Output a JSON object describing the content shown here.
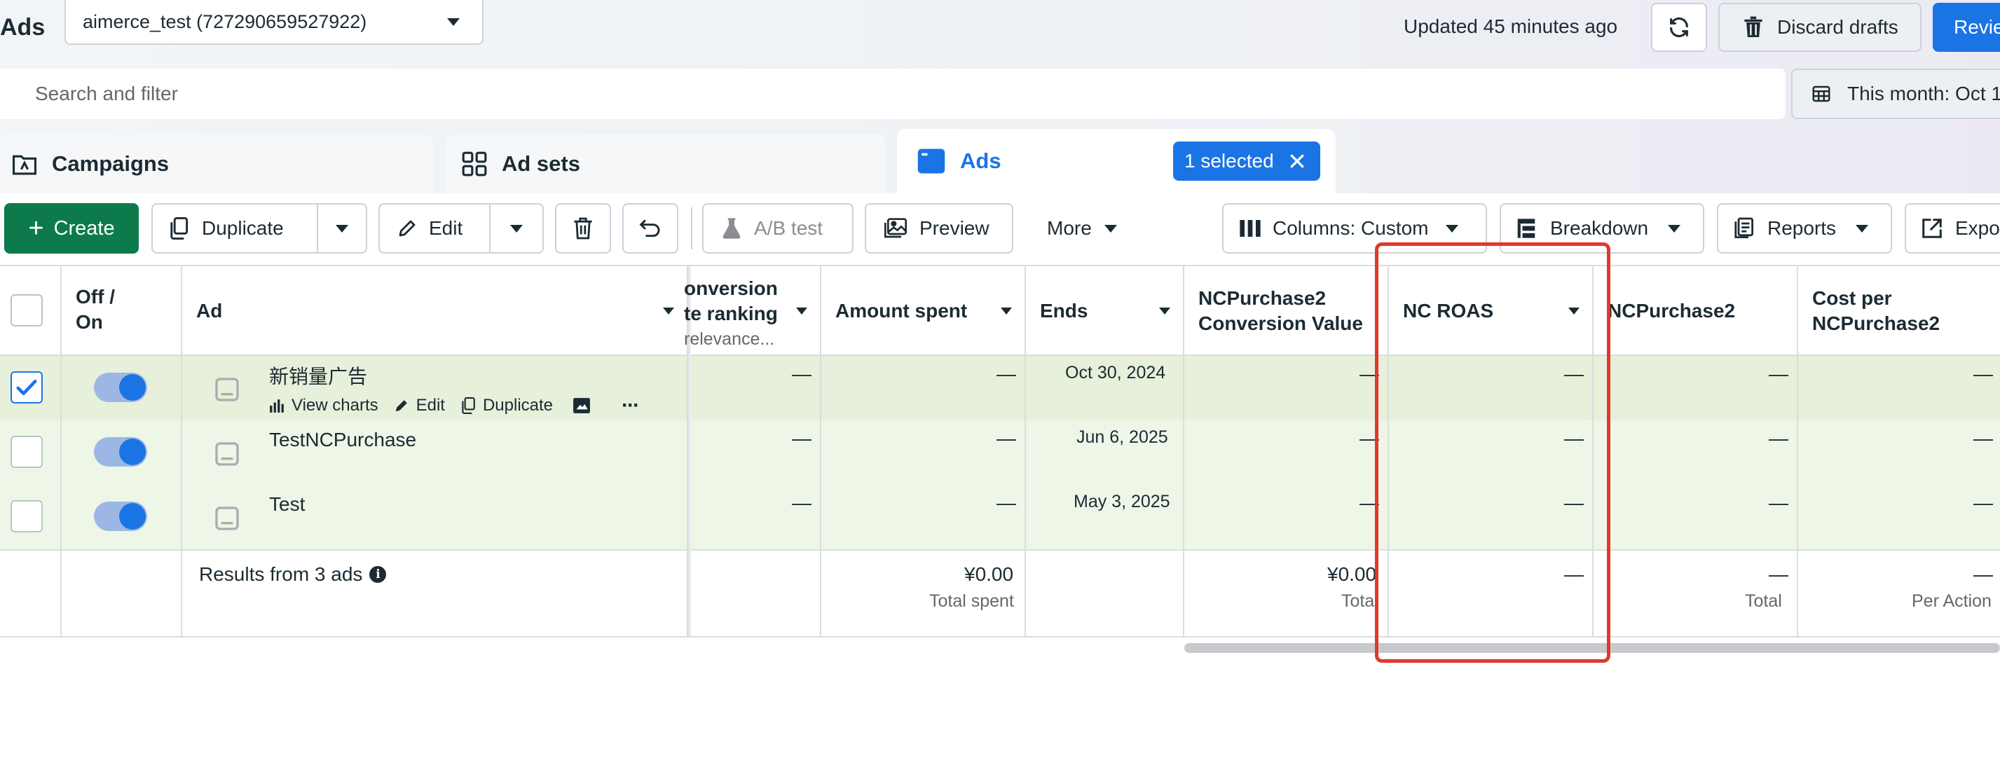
{
  "header": {
    "title": "Ads",
    "account": "aimerce_test (727290659527922)",
    "updated": "Updated 45 minutes ago",
    "discard_label": "Discard drafts",
    "review_label": "Revie"
  },
  "search": {
    "placeholder": "Search and filter"
  },
  "date_range": {
    "label": "This month: Oct 1"
  },
  "tabs": {
    "campaigns": "Campaigns",
    "adsets": "Ad sets",
    "ads": "Ads",
    "selected_chip": "1 selected"
  },
  "toolbar": {
    "create": "Create",
    "duplicate": "Duplicate",
    "edit": "Edit",
    "ab_test": "A/B test",
    "preview": "Preview",
    "more": "More",
    "columns": "Columns: Custom",
    "breakdown": "Breakdown",
    "reports": "Reports",
    "export": "Expo"
  },
  "table": {
    "headers": {
      "off_on_1": "Off /",
      "off_on_2": "On",
      "ad": "Ad",
      "conv_1": "onversion",
      "conv_2": "te ranking",
      "conv_3": "relevance...",
      "amount_spent": "Amount spent",
      "ends": "Ends",
      "ncp_value_1": "NCPurchase2",
      "ncp_value_2": "Conversion Value",
      "nc_roas": "NC ROAS",
      "ncpurchase2": "NCPurchase2",
      "cost_per_1": "Cost per",
      "cost_per_2": "NCPurchase2"
    },
    "rows": [
      {
        "name": "新销量广告",
        "ends": "Oct 30, 2024",
        "actions": {
          "view_charts": "View charts",
          "edit": "Edit",
          "duplicate": "Duplicate",
          "more": "···"
        },
        "dash": "—"
      },
      {
        "name": "TestNCPurchase",
        "ends": "Jun 6, 2025",
        "dash": "—"
      },
      {
        "name": "Test",
        "ends": "May 3, 2025",
        "dash": "—"
      }
    ],
    "summary": {
      "label": "Results from 3 ads",
      "amount_spent": "¥0.00",
      "amount_spent_sub": "Total spent",
      "ncp_value": "¥0.00",
      "ncp_value_sub": "Tota",
      "nc_roas": "—",
      "ncpurchase2": "—",
      "ncpurchase2_sub": "Total",
      "cost_per": "—",
      "cost_per_sub": "Per Action"
    }
  },
  "colors": {
    "accent": "#1b74e4",
    "create_green": "#0d7a4b",
    "selected_row": "#e6f0da",
    "row_bg": "#eef6e7",
    "highlight_red": "#e0392b"
  }
}
